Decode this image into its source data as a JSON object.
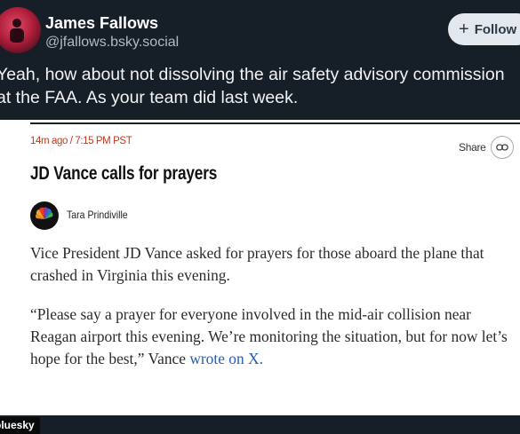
{
  "post": {
    "author_name": "James Fallows",
    "author_handle": "@jfallows.bsky.social",
    "follow_label": "Follow",
    "text": "Yeah, how about not dissolving the air safety advisory commission at the FAA. As your team did last week."
  },
  "embed": {
    "timestamp": "14m ago / 7:15 PM PST",
    "share_label": "Share",
    "headline": "JD Vance calls for prayers",
    "author": "Tara Prindiville",
    "paragraph1": "Vice President JD Vance asked for prayers for those aboard the plane that crashed in Virginia this evening.",
    "paragraph2": "“Please say a prayer for everyone involved in the mid-air collision near Reagan airport this evening. We’re monitoring the situation, but for now let’s hope for the best,” Vance",
    "link_text": "wrote on X."
  },
  "footer": {
    "watermark": "bluesky"
  },
  "colors": {
    "background": "#161e27",
    "timestamp": "#c3391b",
    "link": "#2a5db0"
  },
  "icons": {
    "plus": "plus-icon",
    "share": "link-icon",
    "author_logo": "nbc-peacock-icon"
  }
}
